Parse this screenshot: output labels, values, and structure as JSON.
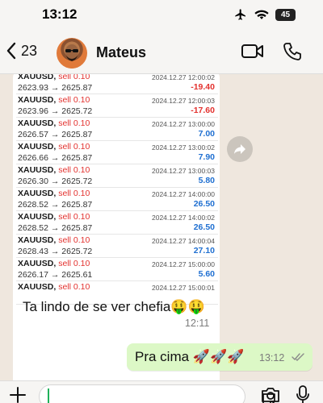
{
  "status_bar": {
    "time": "13:12",
    "battery": "45"
  },
  "header": {
    "back_count": "23",
    "contact_name": "Mateus"
  },
  "trades": [
    {
      "symbol": "XAUUSD",
      "side": "sell 0.10",
      "date": "2024.12.27 12:00:02",
      "prices": "2623.93 → 2625.87",
      "profit": "-19.40",
      "sign": "neg"
    },
    {
      "symbol": "XAUUSD",
      "side": "sell 0.10",
      "date": "2024.12.27 12:00:03",
      "prices": "2623.96 → 2625.72",
      "profit": "-17.60",
      "sign": "neg"
    },
    {
      "symbol": "XAUUSD",
      "side": "sell 0.10",
      "date": "2024.12.27 13:00:00",
      "prices": "2626.57 → 2625.87",
      "profit": "7.00",
      "sign": "pos"
    },
    {
      "symbol": "XAUUSD",
      "side": "sell 0.10",
      "date": "2024.12.27 13:00:02",
      "prices": "2626.66 → 2625.87",
      "profit": "7.90",
      "sign": "pos"
    },
    {
      "symbol": "XAUUSD",
      "side": "sell 0.10",
      "date": "2024.12.27 13:00:03",
      "prices": "2626.30 → 2625.72",
      "profit": "5.80",
      "sign": "pos"
    },
    {
      "symbol": "XAUUSD",
      "side": "sell 0.10",
      "date": "2024.12.27 14:00:00",
      "prices": "2628.52 → 2625.87",
      "profit": "26.50",
      "sign": "pos"
    },
    {
      "symbol": "XAUUSD",
      "side": "sell 0.10",
      "date": "2024.12.27 14:00:02",
      "prices": "2628.52 → 2625.87",
      "profit": "26.50",
      "sign": "pos"
    },
    {
      "symbol": "XAUUSD",
      "side": "sell 0.10",
      "date": "2024.12.27 14:00:04",
      "prices": "2628.43 → 2625.72",
      "profit": "27.10",
      "sign": "pos"
    },
    {
      "symbol": "XAUUSD",
      "side": "sell 0.10",
      "date": "2024.12.27 15:00:00",
      "prices": "2626.17 → 2625.61",
      "profit": "5.60",
      "sign": "pos"
    },
    {
      "symbol": "XAUUSD",
      "side": "sell 0.10",
      "date": "2024.12.27 15:00:01",
      "prices": "",
      "profit": "",
      "sign": "pos"
    }
  ],
  "received_message": {
    "caption": "Ta lindo de se ver chefia🤑🤑",
    "time": "12:11"
  },
  "sent_message": {
    "text": "Pra cima 🚀🚀🚀",
    "time": "13:12"
  },
  "colors": {
    "sent_bubble": "#dcf8c6",
    "received_bubble": "#ffffff",
    "loss": "#e3312e",
    "profit": "#1f6fd1"
  }
}
